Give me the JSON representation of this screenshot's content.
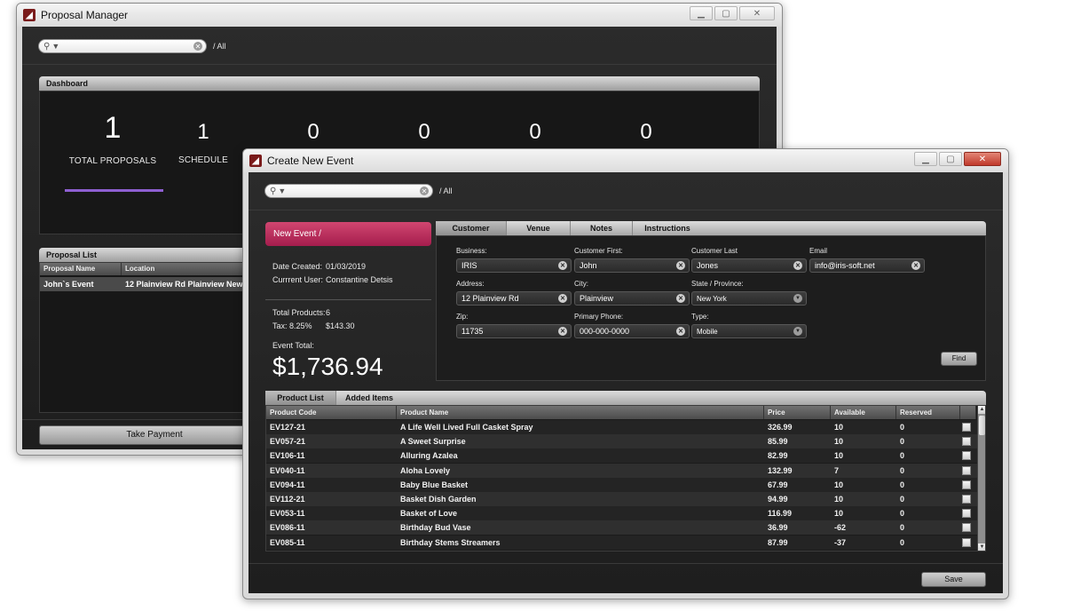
{
  "proposal_manager": {
    "title": "Proposal Manager",
    "search": {
      "value": "",
      "breadcrumb": "/ All"
    },
    "dashboard": {
      "header": "Dashboard",
      "stats": [
        {
          "value": "1",
          "label": "TOTAL PROPOSALS"
        },
        {
          "value": "1",
          "label": "SCHEDULE"
        },
        {
          "value": "0",
          "label": ""
        },
        {
          "value": "0",
          "label": ""
        },
        {
          "value": "0",
          "label": ""
        },
        {
          "value": "0",
          "label": ""
        }
      ],
      "selected_indicator_color": "#8e5fd1"
    },
    "proposal_list": {
      "header": "Proposal List",
      "columns": [
        "Proposal Name",
        "Location"
      ],
      "rows": [
        {
          "name": "John`s Event",
          "location": "12 Plainview Rd Plainview New"
        }
      ]
    },
    "take_payment_label": "Take Payment"
  },
  "create_event": {
    "title": "Create New Event",
    "search": {
      "value": "",
      "breadcrumb": "/ All"
    },
    "new_event_label": "New Event /",
    "date_created_label": "Date Created:",
    "date_created_value": "01/03/2019",
    "current_user_label": "Currrent User:",
    "current_user_value": "Constantine Detsis",
    "total_products_label": "Total Products:",
    "total_products_value": "6",
    "tax_label": "Tax: 8.25%",
    "tax_value": "$143.30",
    "event_total_label": "Event Total:",
    "event_total_value": "$1,736.94",
    "tabs": [
      "Customer",
      "Venue",
      "Notes",
      "Instructions"
    ],
    "active_tab": "Customer",
    "form": {
      "business_label": "Business:",
      "business_value": "IRIS",
      "first_label": "Customer First:",
      "first_value": "John",
      "last_label": "Customer Last",
      "last_value": "Jones",
      "email_label": "Email",
      "email_value": "info@iris-soft.net",
      "address_label": "Address:",
      "address_value": "12 Plainview Rd",
      "city_label": "City:",
      "city_value": "Plainview",
      "state_label": "State / Province:",
      "state_value": "New York",
      "zip_label": "Zip:",
      "zip_value": "11735",
      "phone_label": "Primary Phone:",
      "phone_value": "000-000-0000",
      "type_label": "Type:",
      "type_value": "Mobile"
    },
    "find_label": "Find",
    "product_tabs": [
      "Product List",
      "Added Items"
    ],
    "product_columns": [
      "Product Code",
      "Product Name",
      "Price",
      "Available",
      "Reserved"
    ],
    "products": [
      {
        "code": "EV127-21",
        "name": "A Life Well Lived Full Casket Spray",
        "price": "326.99",
        "available": "10",
        "reserved": "0",
        "checked": false
      },
      {
        "code": "EV057-21",
        "name": "A Sweet Surprise",
        "price": "85.99",
        "available": "10",
        "reserved": "0",
        "checked": true
      },
      {
        "code": "EV106-11",
        "name": "Alluring Azalea",
        "price": "82.99",
        "available": "10",
        "reserved": "0",
        "checked": true
      },
      {
        "code": "EV040-11",
        "name": "Aloha Lovely",
        "price": "132.99",
        "available": "7",
        "reserved": "0",
        "checked": false
      },
      {
        "code": "EV094-11",
        "name": "Baby Blue Basket",
        "price": "67.99",
        "available": "10",
        "reserved": "0",
        "checked": false
      },
      {
        "code": "EV112-21",
        "name": "Basket Dish Garden",
        "price": "94.99",
        "available": "10",
        "reserved": "0",
        "checked": true
      },
      {
        "code": "EV053-11",
        "name": "Basket of Love",
        "price": "116.99",
        "available": "10",
        "reserved": "0",
        "checked": false
      },
      {
        "code": "EV086-11",
        "name": "Birthday Bud Vase",
        "price": "36.99",
        "available": "-62",
        "reserved": "0",
        "checked": false
      },
      {
        "code": "EV085-11",
        "name": "Birthday Stems Streamers",
        "price": "87.99",
        "available": "-37",
        "reserved": "0",
        "checked": false
      }
    ],
    "save_label": "Save"
  }
}
